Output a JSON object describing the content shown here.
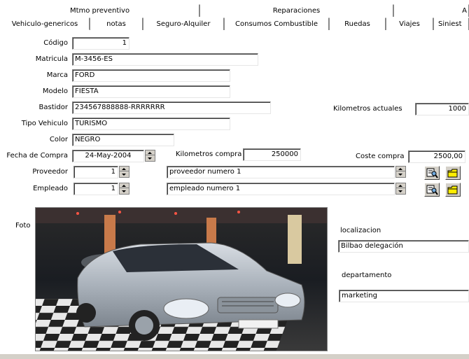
{
  "tabs_row1": [
    "Mtmo preventivo",
    "Reparaciones",
    "A"
  ],
  "tabs_row2": [
    "Vehiculo-genericos",
    "notas",
    "Seguro-Alquiler",
    "Consumos Combustible",
    "Ruedas",
    "Viajes",
    "Siniest"
  ],
  "form": {
    "codigo": {
      "label": "Código",
      "value": "1"
    },
    "matricula": {
      "label": "Matricula",
      "value": "M-3456-ES"
    },
    "marca": {
      "label": "Marca",
      "value": "FORD"
    },
    "modelo": {
      "label": "Modelo",
      "value": "FIESTA"
    },
    "bastidor": {
      "label": "Bastidor",
      "value": "234567888888-RRRRRRR"
    },
    "tipo": {
      "label": "Tipo Vehiculo",
      "value": "TURISMO"
    },
    "color": {
      "label": "Color",
      "value": "NEGRO"
    },
    "km_actuales": {
      "label": "Kilometros actuales",
      "value": "1000"
    },
    "fecha_compra": {
      "label": "Fecha de Compra",
      "value": "24-May-2004"
    },
    "km_compra": {
      "label": "Kilometros compra",
      "value": "250000"
    },
    "coste_compra": {
      "label": "Coste compra",
      "value": "2500,00"
    },
    "proveedor": {
      "label": "Proveedor",
      "id": "1",
      "name": "proveedor numero 1"
    },
    "empleado": {
      "label": "Empleado",
      "id": "1",
      "name": "empleado numero 1"
    },
    "foto": {
      "label": "Foto"
    },
    "localizacion": {
      "label": "localizacion",
      "value": "Bilbao delegación"
    },
    "departamento": {
      "label": "departamento",
      "value": "marketing"
    }
  },
  "icons": {
    "lookup": "search-list-icon",
    "open": "folder-icon"
  }
}
